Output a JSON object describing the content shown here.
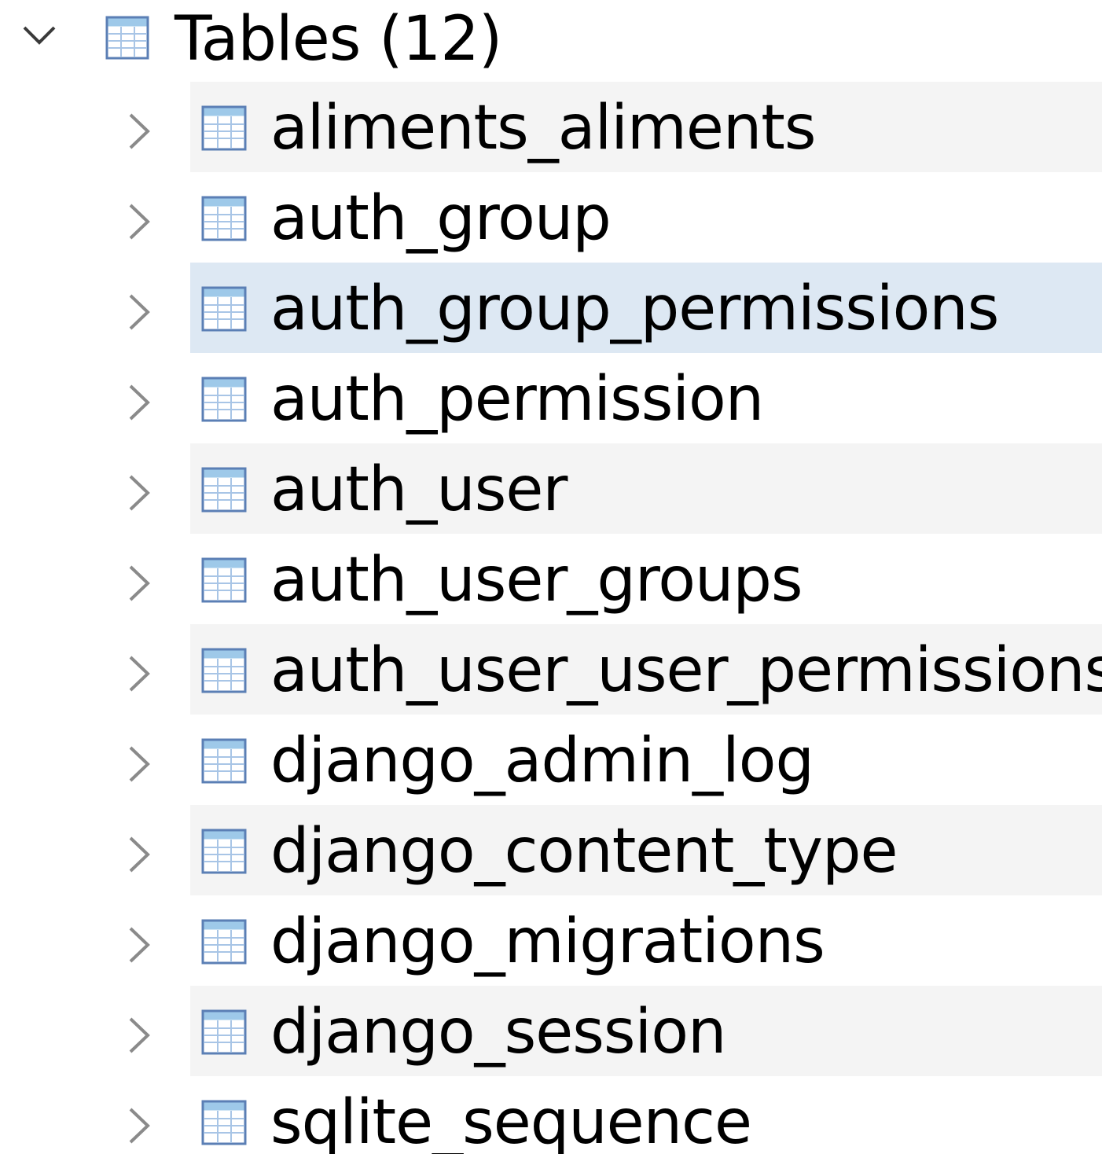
{
  "tree": {
    "root": {
      "label": "Tables (12)",
      "expanded": true,
      "chevron_icon": "chevron-down-icon",
      "icon": "table-icon"
    },
    "items": [
      {
        "label": "aliments_aliments",
        "chevron_icon": "chevron-right-icon",
        "icon": "table-icon",
        "state": "alt"
      },
      {
        "label": "auth_group",
        "chevron_icon": "chevron-right-icon",
        "icon": "table-icon",
        "state": "normal"
      },
      {
        "label": "auth_group_permissions",
        "chevron_icon": "chevron-right-icon",
        "icon": "table-icon",
        "state": "hover"
      },
      {
        "label": "auth_permission",
        "chevron_icon": "chevron-right-icon",
        "icon": "table-icon",
        "state": "normal"
      },
      {
        "label": "auth_user",
        "chevron_icon": "chevron-right-icon",
        "icon": "table-icon",
        "state": "alt"
      },
      {
        "label": "auth_user_groups",
        "chevron_icon": "chevron-right-icon",
        "icon": "table-icon",
        "state": "normal"
      },
      {
        "label": "auth_user_user_permissions",
        "chevron_icon": "chevron-right-icon",
        "icon": "table-icon",
        "state": "alt"
      },
      {
        "label": "django_admin_log",
        "chevron_icon": "chevron-right-icon",
        "icon": "table-icon",
        "state": "normal"
      },
      {
        "label": "django_content_type",
        "chevron_icon": "chevron-right-icon",
        "icon": "table-icon",
        "state": "alt"
      },
      {
        "label": "django_migrations",
        "chevron_icon": "chevron-right-icon",
        "icon": "table-icon",
        "state": "normal"
      },
      {
        "label": "django_session",
        "chevron_icon": "chevron-right-icon",
        "icon": "table-icon",
        "state": "alt"
      },
      {
        "label": "sqlite_sequence",
        "chevron_icon": "chevron-right-icon",
        "icon": "table-icon",
        "state": "normal"
      }
    ]
  },
  "colors": {
    "alt_row": "#f4f4f4",
    "hover_row": "#dde8f3",
    "chevron": "#8a8a8a",
    "icon_border": "#5b7fb5",
    "icon_header": "#9ec9e9",
    "icon_grid": "#a8c5e6",
    "text": "#000000"
  }
}
